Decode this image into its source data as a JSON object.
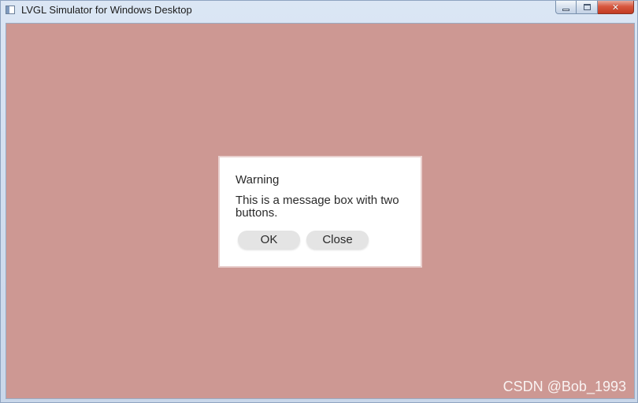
{
  "window": {
    "title": "LVGL Simulator for Windows Desktop",
    "controls": {
      "minimize_icon": "minimize-icon",
      "maximize_icon": "maximize-icon",
      "close_icon": "close-icon",
      "close_glyph": "✕"
    }
  },
  "screen": {
    "background_color": "#cd9893"
  },
  "msgbox": {
    "title": "Warning",
    "text": "This is a message box with two buttons.",
    "buttons": [
      {
        "label": "OK"
      },
      {
        "label": "Close"
      }
    ]
  },
  "watermark": {
    "text": "CSDN @Bob_1993"
  }
}
